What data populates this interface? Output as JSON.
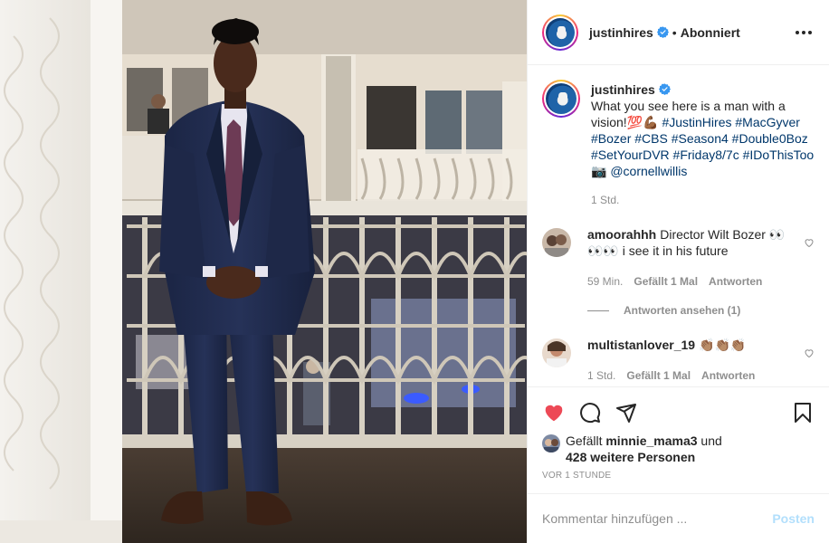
{
  "header": {
    "username": "justinhires",
    "separator": "•",
    "follow_state": "Abonniert"
  },
  "caption": {
    "username": "justinhires",
    "text_before": "What you see here is a man with a vision!",
    "emoji": "💯💪🏾",
    "hashtags": [
      "#JustinHires",
      "#MacGyver",
      "#Bozer",
      "#CBS",
      "#Season4",
      "#Double0Boz",
      "#SetYourDVR",
      "#Friday8/7c",
      "#IDoThisToo"
    ],
    "camera": "📷",
    "mention": "@cornellwillis",
    "time": "1 Std."
  },
  "comments": [
    {
      "username": "amoorahhh",
      "text": "Director Wilt Bozer 👀👀👀 i see it in his future",
      "time": "59 Min.",
      "likes": "Gefällt 1 Mal",
      "reply": "Antworten",
      "view_replies": "Antworten ansehen (1)"
    },
    {
      "username": "multistanlover_19",
      "text": "👏🏽👏🏽👏🏽",
      "time": "1 Std.",
      "likes": "Gefällt 1 Mal",
      "reply": "Antworten"
    }
  ],
  "likes": {
    "prefix": "Gefällt",
    "user": "minnie_mama3",
    "connector": "und",
    "others": "428 weitere Personen"
  },
  "post_time": "VOR 1 STUNDE",
  "add_comment": {
    "placeholder": "Kommentar hinzufügen ...",
    "post_label": "Posten"
  },
  "colors": {
    "heart": "#ed4956",
    "link": "#00376b",
    "muted": "#8e8e8e",
    "post_disabled": "#b2dffc",
    "verified": "#3897f0"
  },
  "icons": [
    "more-icon",
    "verified-icon",
    "heart-icon",
    "comment-icon",
    "share-icon",
    "bookmark-icon",
    "like-icon"
  ]
}
